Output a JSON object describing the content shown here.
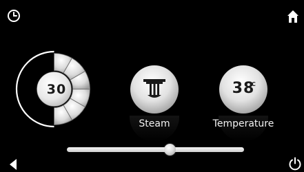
{
  "icons": {
    "clock": "clock-icon",
    "home": "home-icon",
    "back": "back-arrow-icon",
    "power": "power-icon",
    "steam": "steam-nozzle-icon"
  },
  "timer_dial": {
    "value": "30"
  },
  "steam_button": {
    "label": "Steam"
  },
  "temperature_button": {
    "value": "38",
    "unit": "°C",
    "label": "Temperature"
  },
  "slider": {
    "level": 0.58
  },
  "colors": {
    "background": "#000000",
    "foreground": "#ffffff"
  }
}
